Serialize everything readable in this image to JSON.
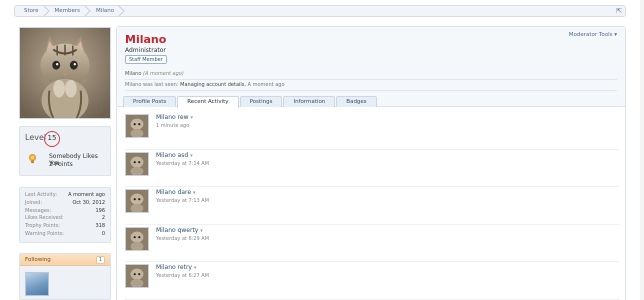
{
  "breadcrumb": {
    "items": [
      "Store",
      "Members",
      "Milano"
    ]
  },
  "profile": {
    "name": "Milano",
    "title": "Administrator",
    "badge": "Staff Member",
    "status_name": "Milano",
    "status_time": "A moment ago",
    "last_seen": {
      "prefix": "Milano was last seen:",
      "activity": "Managing account details,",
      "time": "A moment ago"
    },
    "moderator_tools": "Moderator Tools"
  },
  "tabs": [
    {
      "label": "Profile Posts",
      "active": false
    },
    {
      "label": "Recent Activity",
      "active": true
    },
    {
      "label": "Postings",
      "active": false
    },
    {
      "label": "Information",
      "active": false
    },
    {
      "label": "Badges",
      "active": false
    }
  ],
  "level": {
    "label": "Level",
    "value": "15"
  },
  "award": {
    "title": "Somebody Likes You",
    "points": "2 Points"
  },
  "stats": [
    {
      "k": "Last Activity:",
      "v": "A moment ago"
    },
    {
      "k": "Joined:",
      "v": "Oct 30, 2012"
    },
    {
      "k": "Messages:",
      "v": "196"
    },
    {
      "k": "Likes Received:",
      "v": "2"
    },
    {
      "k": "Trophy Points:",
      "v": "318"
    },
    {
      "k": "Warning Points:",
      "v": "0"
    }
  ],
  "following": {
    "label": "Following",
    "count": "1"
  },
  "activity": [
    {
      "title": "Milano rew",
      "time": "1 minute ago"
    },
    {
      "title": "Milano asd",
      "time": "Yesterday at 7:14 AM"
    },
    {
      "title": "Milano dare",
      "time": "Yesterday at 7:13 AM"
    },
    {
      "title": "Milano qwerty",
      "time": "Yesterday at 6:29 AM"
    },
    {
      "title": "Milano retry",
      "time": "Yesterday at 6:27 AM"
    }
  ],
  "colors": {
    "username": "#c4252f",
    "accent": "#2f4d6f",
    "level_ring": "#d0424a"
  }
}
